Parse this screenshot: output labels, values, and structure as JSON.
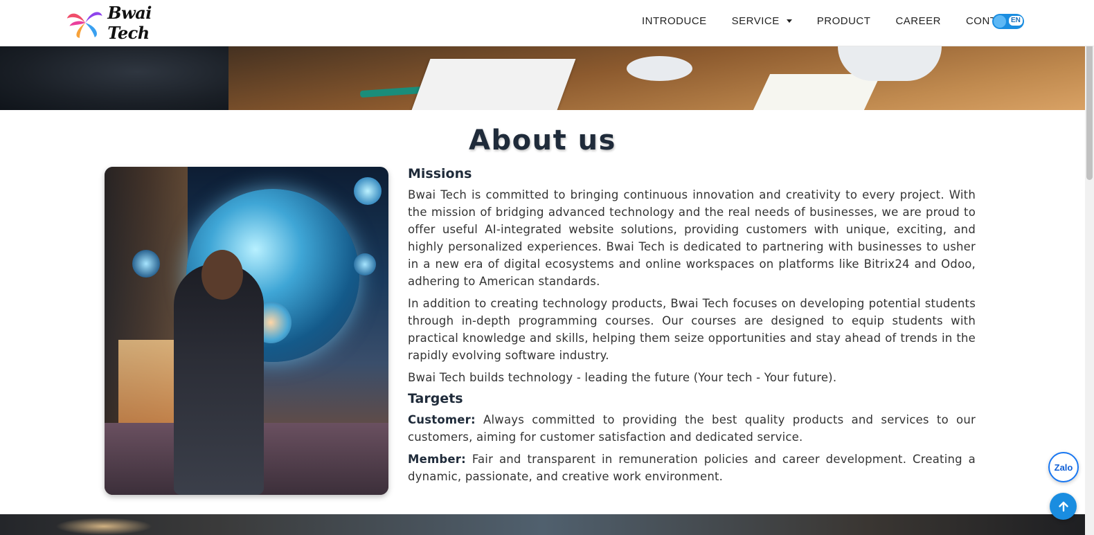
{
  "header": {
    "logo_text": "Bwai Tech",
    "nav": [
      {
        "label": "INTRODUCE"
      },
      {
        "label": "SERVICE",
        "has_dropdown": true
      },
      {
        "label": "PRODUCT"
      },
      {
        "label": "CAREER"
      },
      {
        "label": "CONTACT"
      }
    ],
    "language": "EN"
  },
  "about": {
    "title": "About us",
    "missions_heading": "Missions",
    "missions_paragraphs": [
      "Bwai Tech is committed to bringing continuous innovation and creativity to every project. With the mission of bridging advanced technology and the real needs of businesses, we are proud to offer useful AI-integrated website solutions, providing customers with unique, exciting, and highly personalized experiences. Bwai Tech is dedicated to partnering with businesses to usher in a new era of digital ecosystems and online workspaces on platforms like Bitrix24 and Odoo, adhering to American standards.",
      "In addition to creating technology products, Bwai Tech focuses on developing potential students through in-depth programming courses. Our courses are designed to equip students with practical knowledge and skills, helping them seize opportunities and stay ahead of trends in the rapidly evolving software industry.",
      "Bwai Tech builds technology - leading the future (Your tech - Your future)."
    ],
    "targets_heading": "Targets",
    "targets": [
      {
        "label": "Customer:",
        "text": " Always committed to providing the best quality products and services to our customers, aiming for customer satisfaction and dedicated service."
      },
      {
        "label": "Member:",
        "text": " Fair and transparent in remuneration policies and career development. Creating a dynamic, passionate, and creative work environment."
      }
    ]
  },
  "floating": {
    "zalo_label": "Zalo"
  },
  "colors": {
    "accent": "#1a8de0",
    "heading": "#1f2b3a",
    "zalo": "#0f5fd6"
  },
  "icons": {
    "logo": "pinwheel-logo-icon",
    "dropdown": "caret-down-icon",
    "scroll_top": "arrow-up-icon",
    "chat": "zalo-icon"
  }
}
